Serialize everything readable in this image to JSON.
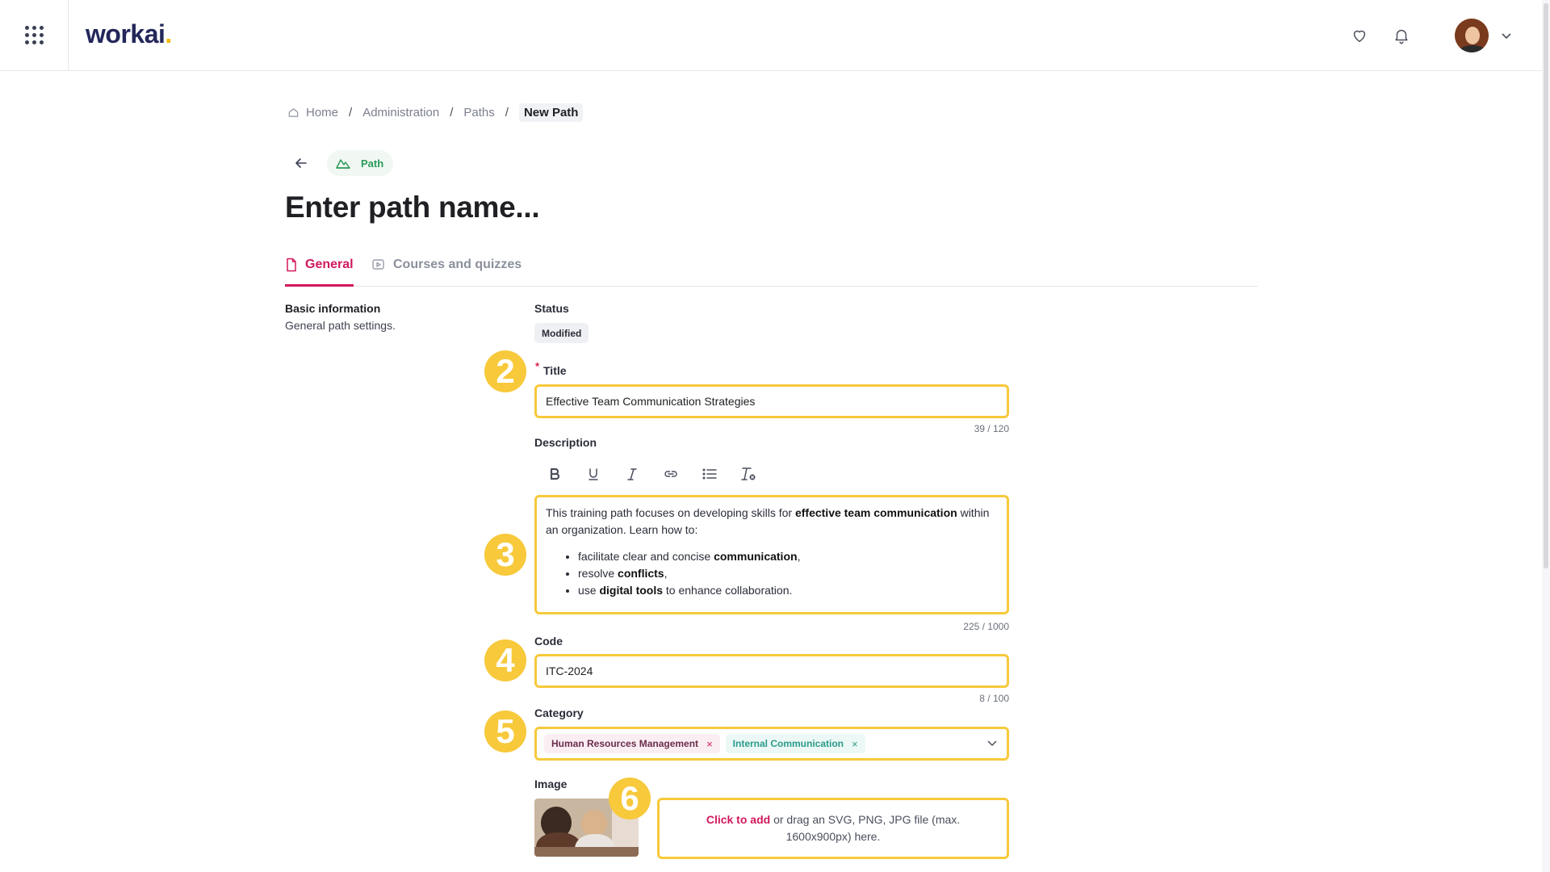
{
  "app": {
    "logo": "workai",
    "logo_dot": "."
  },
  "breadcrumb": {
    "items": [
      "Home",
      "Administration",
      "Paths"
    ],
    "separator": "/",
    "current": "New Path"
  },
  "chip": {
    "label": "Path"
  },
  "page": {
    "title": "Enter path name..."
  },
  "tabs": [
    {
      "label": "General"
    },
    {
      "label": "Courses and quizzes"
    }
  ],
  "section": {
    "title": "Basic information",
    "subtitle": "General path settings."
  },
  "form": {
    "status": {
      "label": "Status",
      "value": "Modified"
    },
    "title": {
      "label": "Title",
      "required_mark": "*",
      "value": "Effective Team Communication Strategies",
      "counter": "39 / 120"
    },
    "description": {
      "label": "Description",
      "toolbar": [
        "bold-icon",
        "underline-icon",
        "italic-icon",
        "link-icon",
        "bullet-list-icon",
        "clear-format-icon"
      ],
      "p1_a": "This training path focuses on developing skills for ",
      "p1_b": "effective team communication",
      "p1_c": " within an organization. Learn how to:",
      "li1_a": "facilitate clear and concise ",
      "li1_b": "communication",
      "li1_c": ",",
      "li2_a": "resolve ",
      "li2_b": "conflicts",
      "li2_c": ",",
      "li3_a": "use ",
      "li3_b": "digital tools",
      "li3_c": " to enhance collaboration.",
      "counter": "225 / 1000"
    },
    "code": {
      "label": "Code",
      "value": "ITC-2024",
      "counter": "8 / 100"
    },
    "category": {
      "label": "Category",
      "tags": [
        {
          "label": "Human Resources Management"
        },
        {
          "label": "Internal Communication"
        }
      ],
      "remove_glyph": "×"
    },
    "image": {
      "label": "Image",
      "dropzone_cta": "Click to add",
      "dropzone_text": " or drag an SVG, PNG, JPG file (max. 1600x900px) here."
    }
  },
  "markers": [
    "2",
    "3",
    "4",
    "5",
    "6"
  ],
  "colors": {
    "accent": "#d1185c",
    "highlight": "#f7c93b",
    "path_green": "#2b9a5a",
    "brand": "#23275a"
  }
}
